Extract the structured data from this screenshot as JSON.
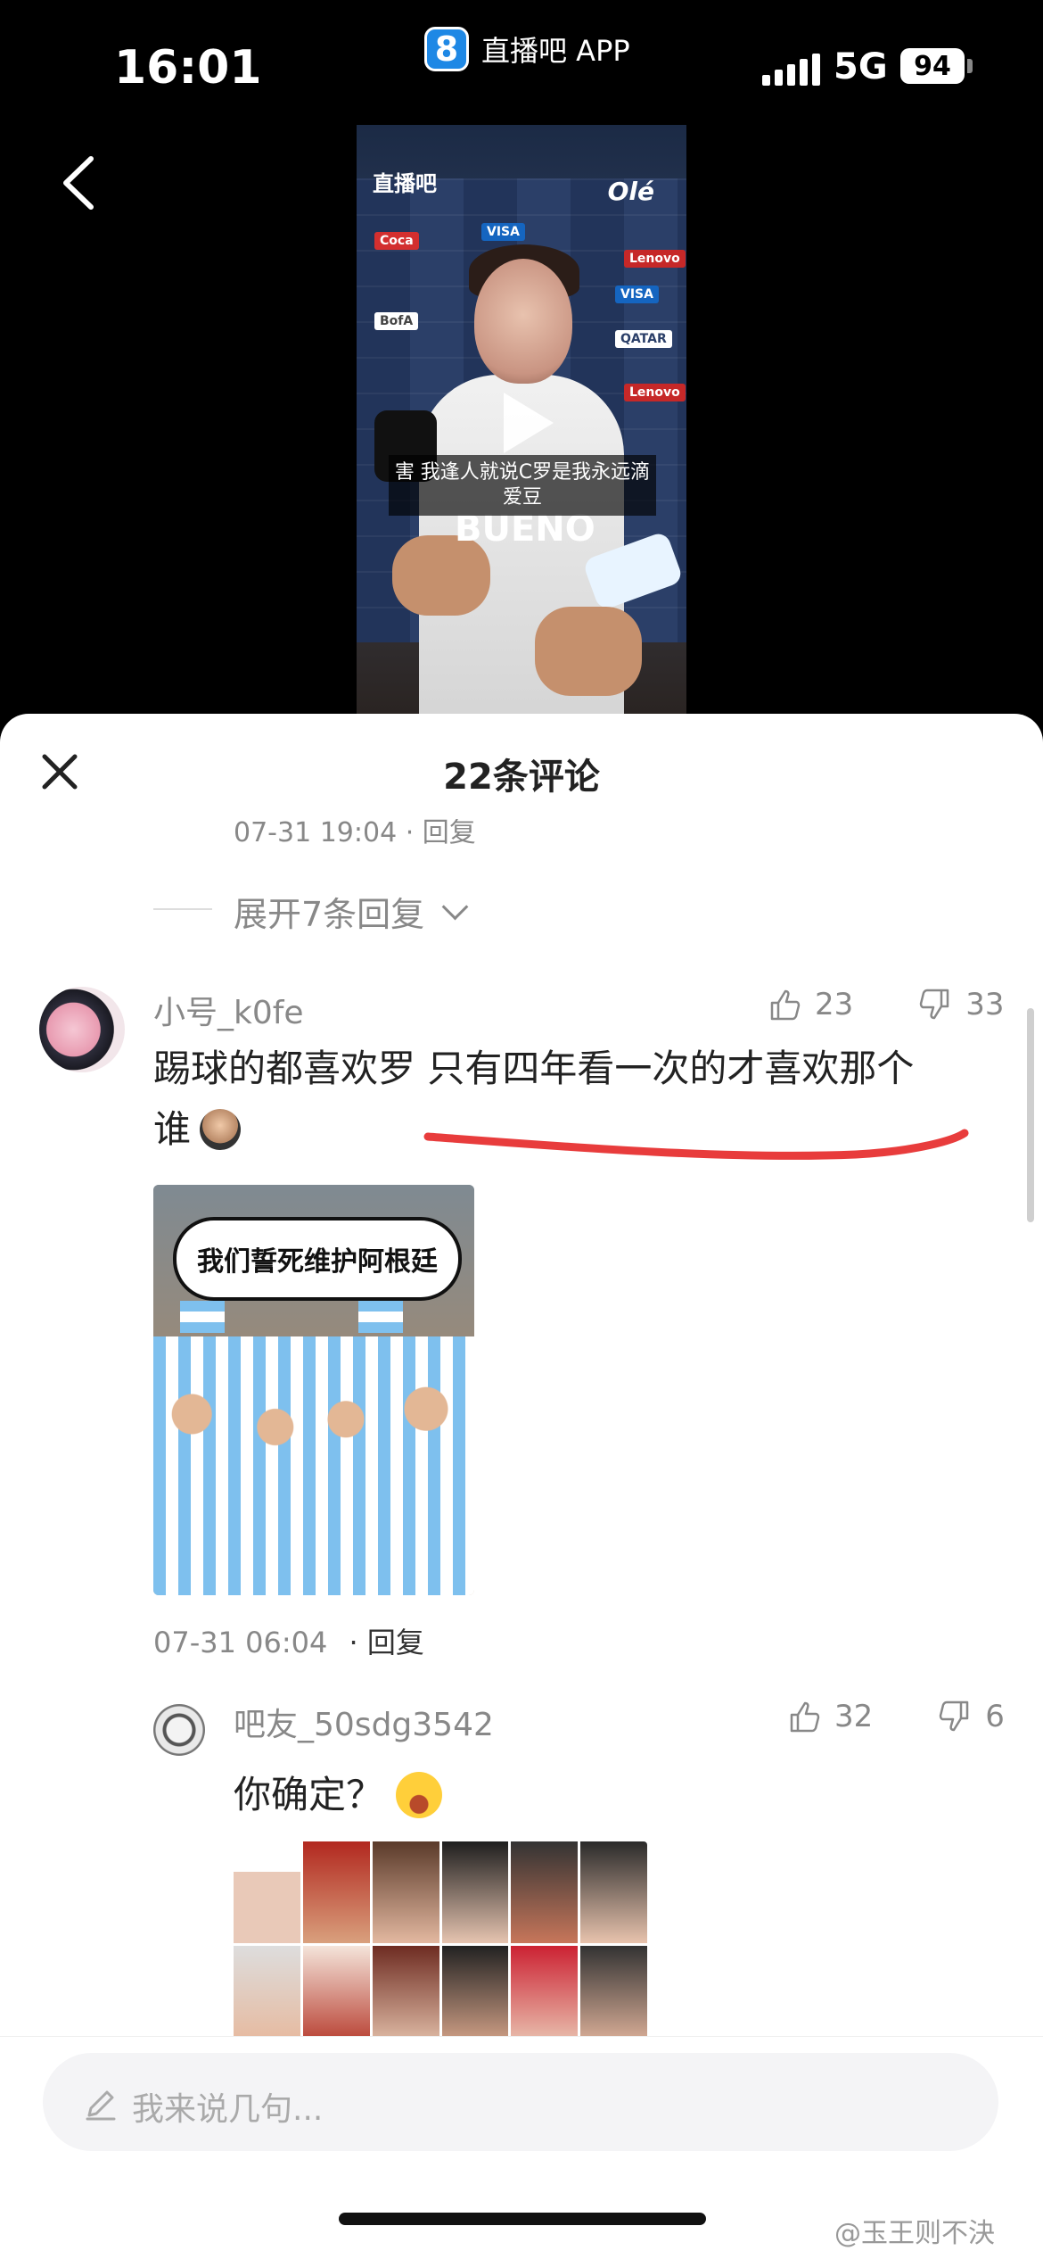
{
  "status_bar": {
    "time": "16:01",
    "app_name": "直播吧 APP",
    "app_logo": "8",
    "network": "5G",
    "battery": "94"
  },
  "video": {
    "watermark": "直播吧",
    "sponsor_logo": "Olé",
    "subtitle": "害 我逢人就说C罗是我永远滴爱豆",
    "shirt_text": "BUENO",
    "icons": [
      "back-arrow-icon",
      "play-icon"
    ]
  },
  "comments_sheet": {
    "title": "22条评论",
    "truncated_meta": "07-31 19:04 · 回复",
    "expand_label": "展开7条回复",
    "comments": [
      {
        "username": "小号_k0fe",
        "likes": "23",
        "dislikes": "33",
        "text_line1": "踢球的都喜欢罗 只有四年看一次的才喜欢那个",
        "text_line2": "谁",
        "image_caption": "我们誓死维护阿根廷",
        "date": "07-31 06:04",
        "reply_label": "· 回复"
      },
      {
        "username": "吧友_50sdg3542",
        "likes": "32",
        "dislikes": "6",
        "text": "你确定？"
      }
    ],
    "input_placeholder": "我来说几句..."
  },
  "footer_watermark": "@玉王则不決",
  "colors": {
    "accent_blue": "#1e88e5",
    "underline_red": "#e83c3c",
    "muted_text": "#888888"
  }
}
